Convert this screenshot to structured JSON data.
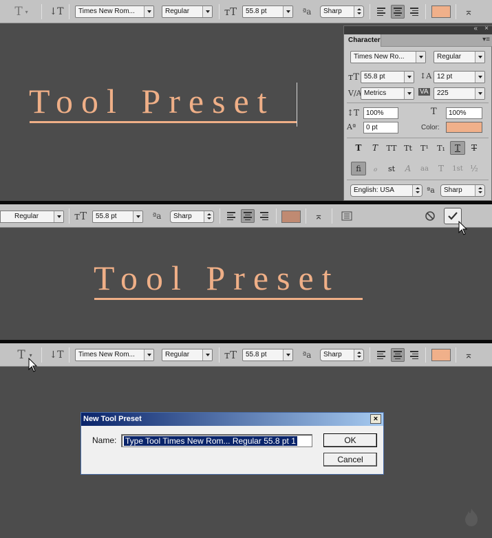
{
  "panel1": {
    "optbar": {
      "tool_icon": "T",
      "font_family": "Times New Rom...",
      "font_style": "Regular",
      "font_size": "55.8 pt",
      "antialias": "Sharp",
      "color": "#f0b08a"
    },
    "canvas_text": "Tool Preset",
    "character_panel": {
      "tab_label": "Character",
      "font_family": "Times New Ro...",
      "font_style": "Regular",
      "font_size": "55.8 pt",
      "leading": "12 pt",
      "kerning": "Metrics",
      "tracking": "225",
      "vertical_scale": "100%",
      "horizontal_scale": "100%",
      "baseline_shift": "0 pt",
      "color_label": "Color:",
      "color": "#f0b08a",
      "language": "English: USA",
      "antialias": "Sharp",
      "type_styles": [
        "T",
        "T",
        "TT",
        "Tt",
        "T¹",
        "T₁",
        "T",
        "T"
      ],
      "opentype": [
        "fi",
        "ℴ",
        "st",
        "A",
        "aa",
        "T",
        "1st",
        "½"
      ]
    }
  },
  "panel2": {
    "optbar": {
      "font_style": "Regular",
      "font_size": "55.8 pt",
      "antialias": "Sharp",
      "color": "#c08a72"
    },
    "canvas_text": "Tool Preset"
  },
  "panel3": {
    "optbar": {
      "tool_icon": "T",
      "font_family": "Times New Rom...",
      "font_style": "Regular",
      "font_size": "55.8 pt",
      "antialias": "Sharp",
      "color": "#f0b08a"
    },
    "dialog": {
      "title": "New Tool Preset",
      "close_label": "×",
      "name_label": "Name:",
      "name_value": "Type Tool Times New Rom... Regular 55.8 pt 1",
      "ok_label": "OK",
      "cancel_label": "Cancel"
    }
  }
}
